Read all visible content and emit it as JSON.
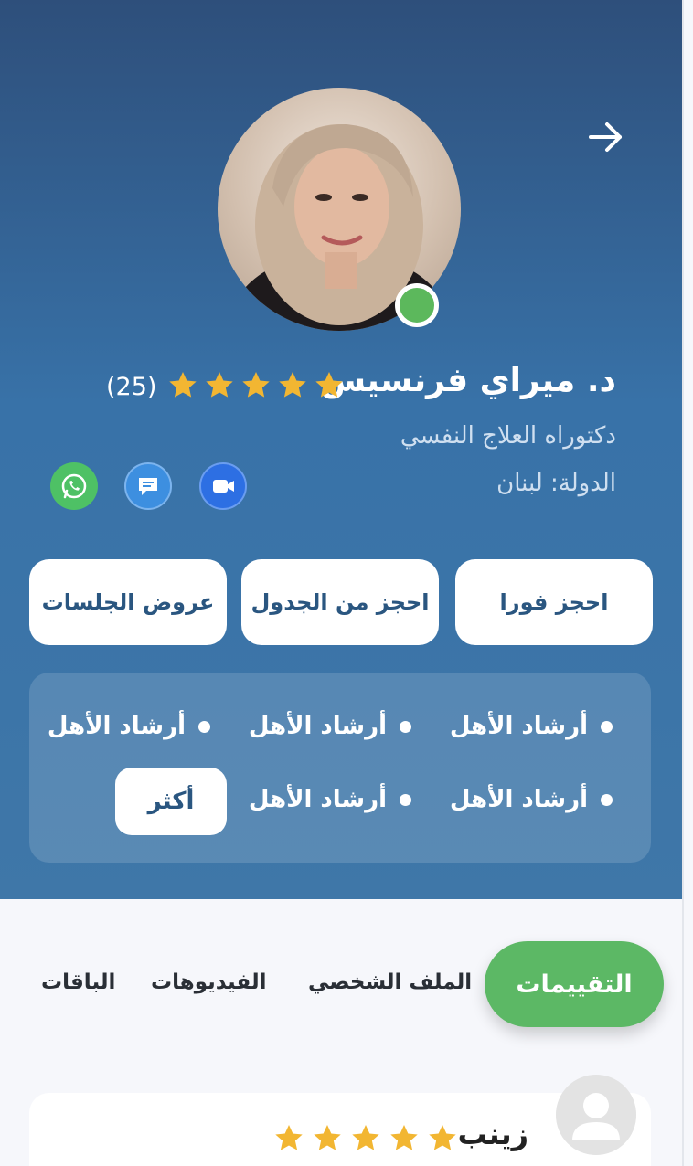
{
  "header": {
    "back_icon": "arrow-right-icon",
    "profile": {
      "name": "د. ميراي فرنسيس",
      "rating": 5,
      "rating_count": "(25)",
      "title": "دكتوراه العلاج النفسي",
      "country": "الدولة: لبنان",
      "online": true
    },
    "contact_icons": [
      "video-call-icon",
      "chat-icon",
      "whatsapp-icon"
    ],
    "actions": {
      "book_now": "احجز فورا",
      "book_schedule": "احجز من الجدول",
      "session_offers": "عروض الجلسات"
    },
    "specialties": {
      "items": [
        "أرشاد الأهل",
        "أرشاد الأهل",
        "أرشاد الأهل",
        "أرشاد الأهل",
        "أرشاد الأهل"
      ],
      "more_label": "أكثر"
    }
  },
  "tabs": [
    {
      "label": "التقييمات",
      "active": true
    },
    {
      "label": "الملف الشخصي",
      "active": false
    },
    {
      "label": "الفيديوهات",
      "active": false
    },
    {
      "label": "الباقات",
      "active": false
    }
  ],
  "reviews": [
    {
      "name": "زينب",
      "rating": 5
    }
  ],
  "colors": {
    "hero_top": "#2e4f7b",
    "hero_bottom": "#3f77a8",
    "accent_green": "#5cb865",
    "star": "#f2b632",
    "button_text": "#2a5680"
  }
}
